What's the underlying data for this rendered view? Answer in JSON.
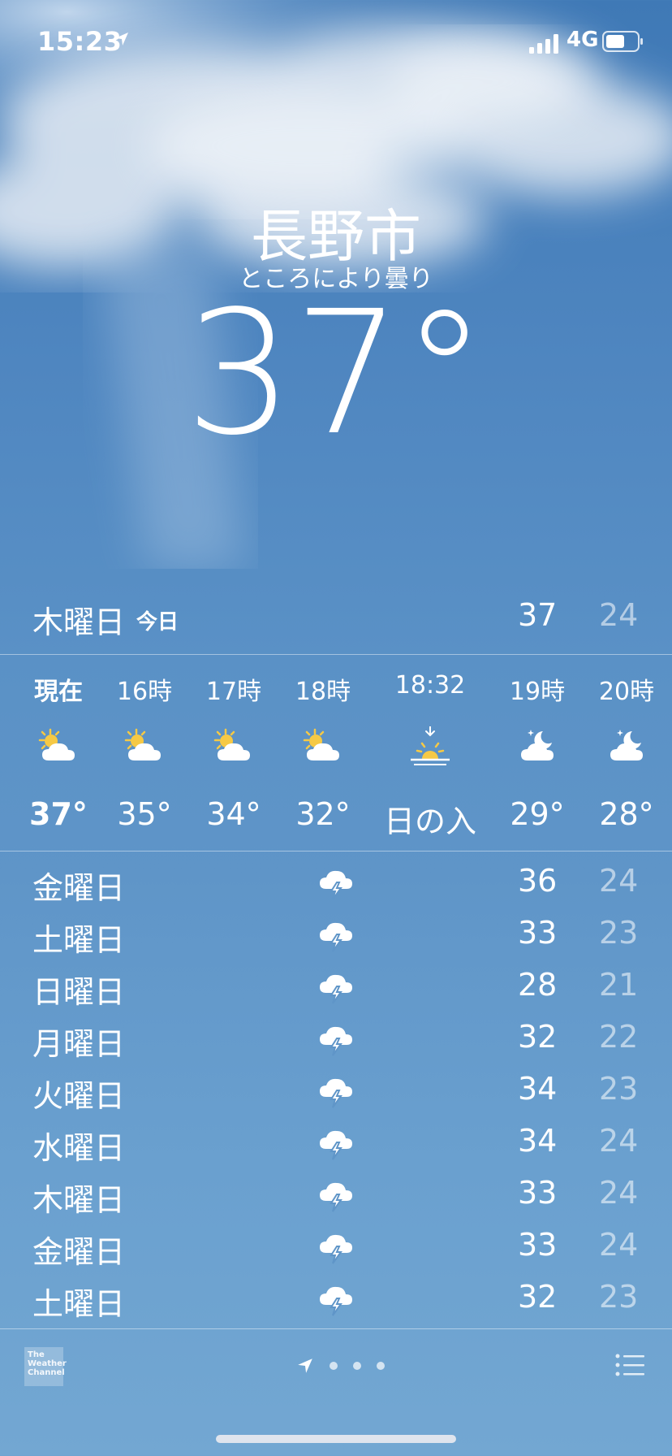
{
  "status_bar": {
    "time": "15:23",
    "network": "4G",
    "icons": [
      "location-arrow-icon",
      "signal-bars-icon",
      "battery-icon"
    ]
  },
  "location": {
    "city": "長野市",
    "condition": "ところにより曇り",
    "temperature": "37°"
  },
  "today": {
    "day": "木曜日",
    "label": "今日",
    "high": "37",
    "low": "24"
  },
  "hourly": [
    {
      "label": "現在",
      "temp": "37°",
      "icon": "partly-sunny-icon"
    },
    {
      "label": "16時",
      "temp": "35°",
      "icon": "partly-sunny-icon"
    },
    {
      "label": "17時",
      "temp": "34°",
      "icon": "partly-sunny-icon"
    },
    {
      "label": "18時",
      "temp": "32°",
      "icon": "partly-sunny-icon"
    },
    {
      "label": "18:32",
      "temp": "日の入",
      "icon": "sunset-icon"
    },
    {
      "label": "19時",
      "temp": "29°",
      "icon": "partly-cloudy-night-icon"
    },
    {
      "label": "20時",
      "temp": "28°",
      "icon": "partly-cloudy-night-icon"
    }
  ],
  "daily": [
    {
      "day": "金曜日",
      "high": "36",
      "low": "24",
      "icon": "thunderstorm-icon"
    },
    {
      "day": "土曜日",
      "high": "33",
      "low": "23",
      "icon": "thunderstorm-icon"
    },
    {
      "day": "日曜日",
      "high": "28",
      "low": "21",
      "icon": "thunderstorm-icon"
    },
    {
      "day": "月曜日",
      "high": "32",
      "low": "22",
      "icon": "thunderstorm-icon"
    },
    {
      "day": "火曜日",
      "high": "34",
      "low": "23",
      "icon": "thunderstorm-icon"
    },
    {
      "day": "水曜日",
      "high": "34",
      "low": "24",
      "icon": "thunderstorm-icon"
    },
    {
      "day": "木曜日",
      "high": "33",
      "low": "24",
      "icon": "thunderstorm-icon"
    },
    {
      "day": "金曜日",
      "high": "33",
      "low": "24",
      "icon": "thunderstorm-icon"
    },
    {
      "day": "土曜日",
      "high": "32",
      "low": "23",
      "icon": "thunderstorm-icon"
    }
  ],
  "footer": {
    "logo_text": [
      "The",
      "Weather",
      "Channel"
    ],
    "page_count": 3
  },
  "colors": {
    "background_top": "#3f79b6",
    "background_bottom": "#73a7d2",
    "sun": "#f6c945",
    "low_temp_text": "rgba(255,255,255,0.55)"
  }
}
